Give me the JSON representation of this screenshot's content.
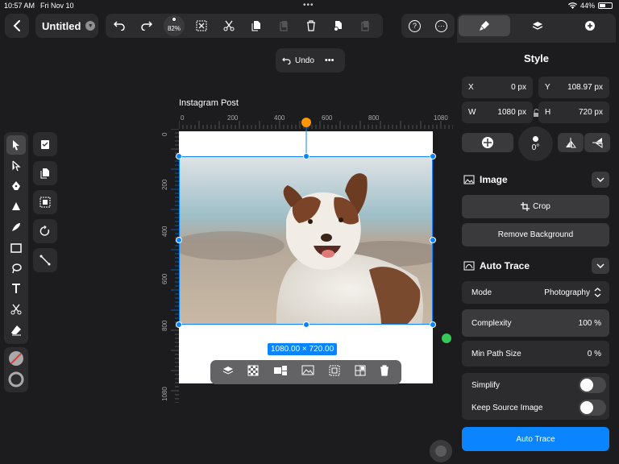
{
  "status_bar": {
    "time": "10:57 AM",
    "date": "Fri Nov 10",
    "battery": "44%"
  },
  "header": {
    "title": "Untitled",
    "zoom": "82%"
  },
  "undo_popup": {
    "label": "Undo"
  },
  "panel": {
    "title": "Style",
    "x": {
      "label": "X",
      "value": "0 px"
    },
    "y": {
      "label": "Y",
      "value": "108.97 px"
    },
    "w": {
      "label": "W",
      "value": "1080 px"
    },
    "h": {
      "label": "H",
      "value": "720 px"
    },
    "rotation": "0°",
    "image_section": "Image",
    "crop_label": "Crop",
    "remove_bg_label": "Remove Background",
    "trace_section": "Auto Trace",
    "mode": {
      "label": "Mode",
      "value": "Photography"
    },
    "complexity": {
      "label": "Complexity",
      "value": "100 %"
    },
    "min_path": {
      "label": "Min Path Size",
      "value": "0 %"
    },
    "simplify": {
      "label": "Simplify",
      "on": false
    },
    "keep_source": {
      "label": "Keep Source Image",
      "on": false
    },
    "auto_trace_button": "Auto Trace"
  },
  "canvas": {
    "doc_name": "Instagram Post",
    "h_ruler": [
      "0",
      "200",
      "400",
      "600",
      "800",
      "1080"
    ],
    "v_ruler": [
      "0",
      "200",
      "400",
      "600",
      "800",
      "1080"
    ],
    "selection_size": "1080.00 × 720.00"
  },
  "colors": {
    "accent": "#0a84ff",
    "rotation_handle": "#ff9500",
    "pivot_handle": "#34c759"
  }
}
